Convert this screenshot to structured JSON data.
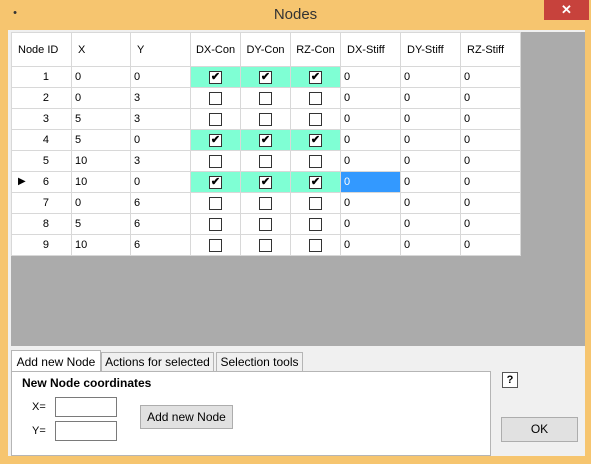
{
  "window": {
    "title": "Nodes",
    "close_glyph": "✕",
    "system_icon": "•"
  },
  "grid": {
    "headers": [
      "Node ID",
      "X",
      "Y",
      "DX-Con",
      "DY-Con",
      "RZ-Con",
      "DX-Stiff",
      "DY-Stiff",
      "RZ-Stiff"
    ],
    "rows": [
      {
        "id": "1",
        "x": "0",
        "y": "0",
        "dx": true,
        "dy": true,
        "rz": true,
        "dxs": "0",
        "dys": "0",
        "rzs": "0",
        "current": false
      },
      {
        "id": "2",
        "x": "0",
        "y": "3",
        "dx": false,
        "dy": false,
        "rz": false,
        "dxs": "0",
        "dys": "0",
        "rzs": "0",
        "current": false
      },
      {
        "id": "3",
        "x": "5",
        "y": "3",
        "dx": false,
        "dy": false,
        "rz": false,
        "dxs": "0",
        "dys": "0",
        "rzs": "0",
        "current": false
      },
      {
        "id": "4",
        "x": "5",
        "y": "0",
        "dx": true,
        "dy": true,
        "rz": true,
        "dxs": "0",
        "dys": "0",
        "rzs": "0",
        "current": false
      },
      {
        "id": "5",
        "x": "10",
        "y": "3",
        "dx": false,
        "dy": false,
        "rz": false,
        "dxs": "0",
        "dys": "0",
        "rzs": "0",
        "current": false
      },
      {
        "id": "6",
        "x": "10",
        "y": "0",
        "dx": true,
        "dy": true,
        "rz": true,
        "dxs": "0",
        "dys": "0",
        "rzs": "0",
        "current": true
      },
      {
        "id": "7",
        "x": "0",
        "y": "6",
        "dx": false,
        "dy": false,
        "rz": false,
        "dxs": "0",
        "dys": "0",
        "rzs": "0",
        "current": false
      },
      {
        "id": "8",
        "x": "5",
        "y": "6",
        "dx": false,
        "dy": false,
        "rz": false,
        "dxs": "0",
        "dys": "0",
        "rzs": "0",
        "current": false
      },
      {
        "id": "9",
        "x": "10",
        "y": "6",
        "dx": false,
        "dy": false,
        "rz": false,
        "dxs": "0",
        "dys": "0",
        "rzs": "0",
        "current": false
      }
    ],
    "checked_glyph": "✔",
    "current_row_glyph": "▶",
    "constraint_color": "#7fffd4",
    "selection_color": "#3399ff"
  },
  "tabs": [
    "Add new Node",
    "Actions for selected",
    "Selection tools"
  ],
  "panel": {
    "heading": "New Node coordinates",
    "x_label": "X=",
    "y_label": "Y=",
    "x_value": "",
    "y_value": "",
    "add_button": "Add new Node"
  },
  "help_glyph": "?",
  "ok_button": "OK"
}
